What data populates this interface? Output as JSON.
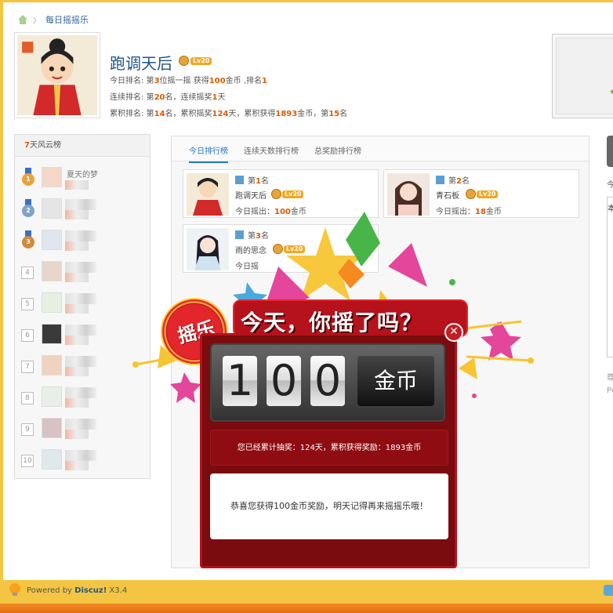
{
  "breadcrumb": {
    "current": "每日摇摇乐"
  },
  "profile": {
    "username": "跑调天后",
    "level_badge": "Lv20",
    "today": {
      "prefix": "今日排名: 第",
      "rank": "3",
      "mid": "位摇一摇 获得",
      "coins": "100",
      "coins_suffix": "金币 ,排名",
      "pos": "1"
    },
    "streak": {
      "prefix": "连续排名: 第",
      "rank": "20",
      "mid": "名，连续摇奖",
      "days": "1",
      "suffix": "天"
    },
    "total": {
      "prefix": "累积排名: 第",
      "rank": "14",
      "mid1": "名，累积摇奖",
      "days": "124",
      "mid2": "天，累积获得",
      "coins": "1893",
      "mid3": "金币，第",
      "pos": "15",
      "suffix": "名"
    }
  },
  "leftboard": {
    "title_num": "7",
    "title_text": "天风云榜",
    "rows": [
      {
        "rank": "1",
        "name": "夏天的梦",
        "color": "#e8a33b"
      },
      {
        "rank": "2",
        "name": "",
        "color": "#7fa3c8"
      },
      {
        "rank": "3",
        "name": "",
        "color": "#d28a3a"
      },
      {
        "rank": "4",
        "name": ""
      },
      {
        "rank": "5",
        "name": ""
      },
      {
        "rank": "6",
        "name": ""
      },
      {
        "rank": "7",
        "name": ""
      },
      {
        "rank": "8",
        "name": ""
      },
      {
        "rank": "9",
        "name": ""
      },
      {
        "rank": "10",
        "name": ""
      }
    ]
  },
  "tabs": [
    {
      "label": "今日排行榜",
      "active": true
    },
    {
      "label": "连续天数排行榜",
      "active": false
    },
    {
      "label": "总奖励排行榜",
      "active": false
    }
  ],
  "cards": [
    {
      "place_prefix": "第",
      "place": "1",
      "place_suffix": "名",
      "name": "跑调天后",
      "today_label": "今日摇出：",
      "today_value": "100",
      "today_suffix": "金币"
    },
    {
      "place_prefix": "第",
      "place": "2",
      "place_suffix": "名",
      "name": "青石板",
      "today_label": "今日摇出：",
      "today_value": "18",
      "today_suffix": "金币"
    },
    {
      "place_prefix": "第",
      "place": "3",
      "place_suffix": "名",
      "name": "雨的思念",
      "today_label": "今日摇",
      "today_value": "",
      "today_suffix": ""
    }
  ],
  "far_right": {
    "text1": "今",
    "text2": "本",
    "text3a": "尊",
    "text3b": "Pc"
  },
  "popup": {
    "badge_text": "摇乐",
    "slogan": "今天，你摇了吗？",
    "digits": [
      "1",
      "0",
      "0"
    ],
    "unit": "金币",
    "summary": "您已经累计抽奖：124天，累积获得奖励：1893金币",
    "message": "恭喜您获得100金币奖励，明天记得再来摇摇乐哦！",
    "close_symbol": "✕"
  },
  "footer": {
    "powered_prefix": "Powered by ",
    "brand": "Discuz!",
    "version": " X3.4"
  },
  "colors": {
    "accent": "#e05a00",
    "link": "#225588",
    "tab_active": "#2277cc",
    "popup_red": "#b5121b"
  }
}
